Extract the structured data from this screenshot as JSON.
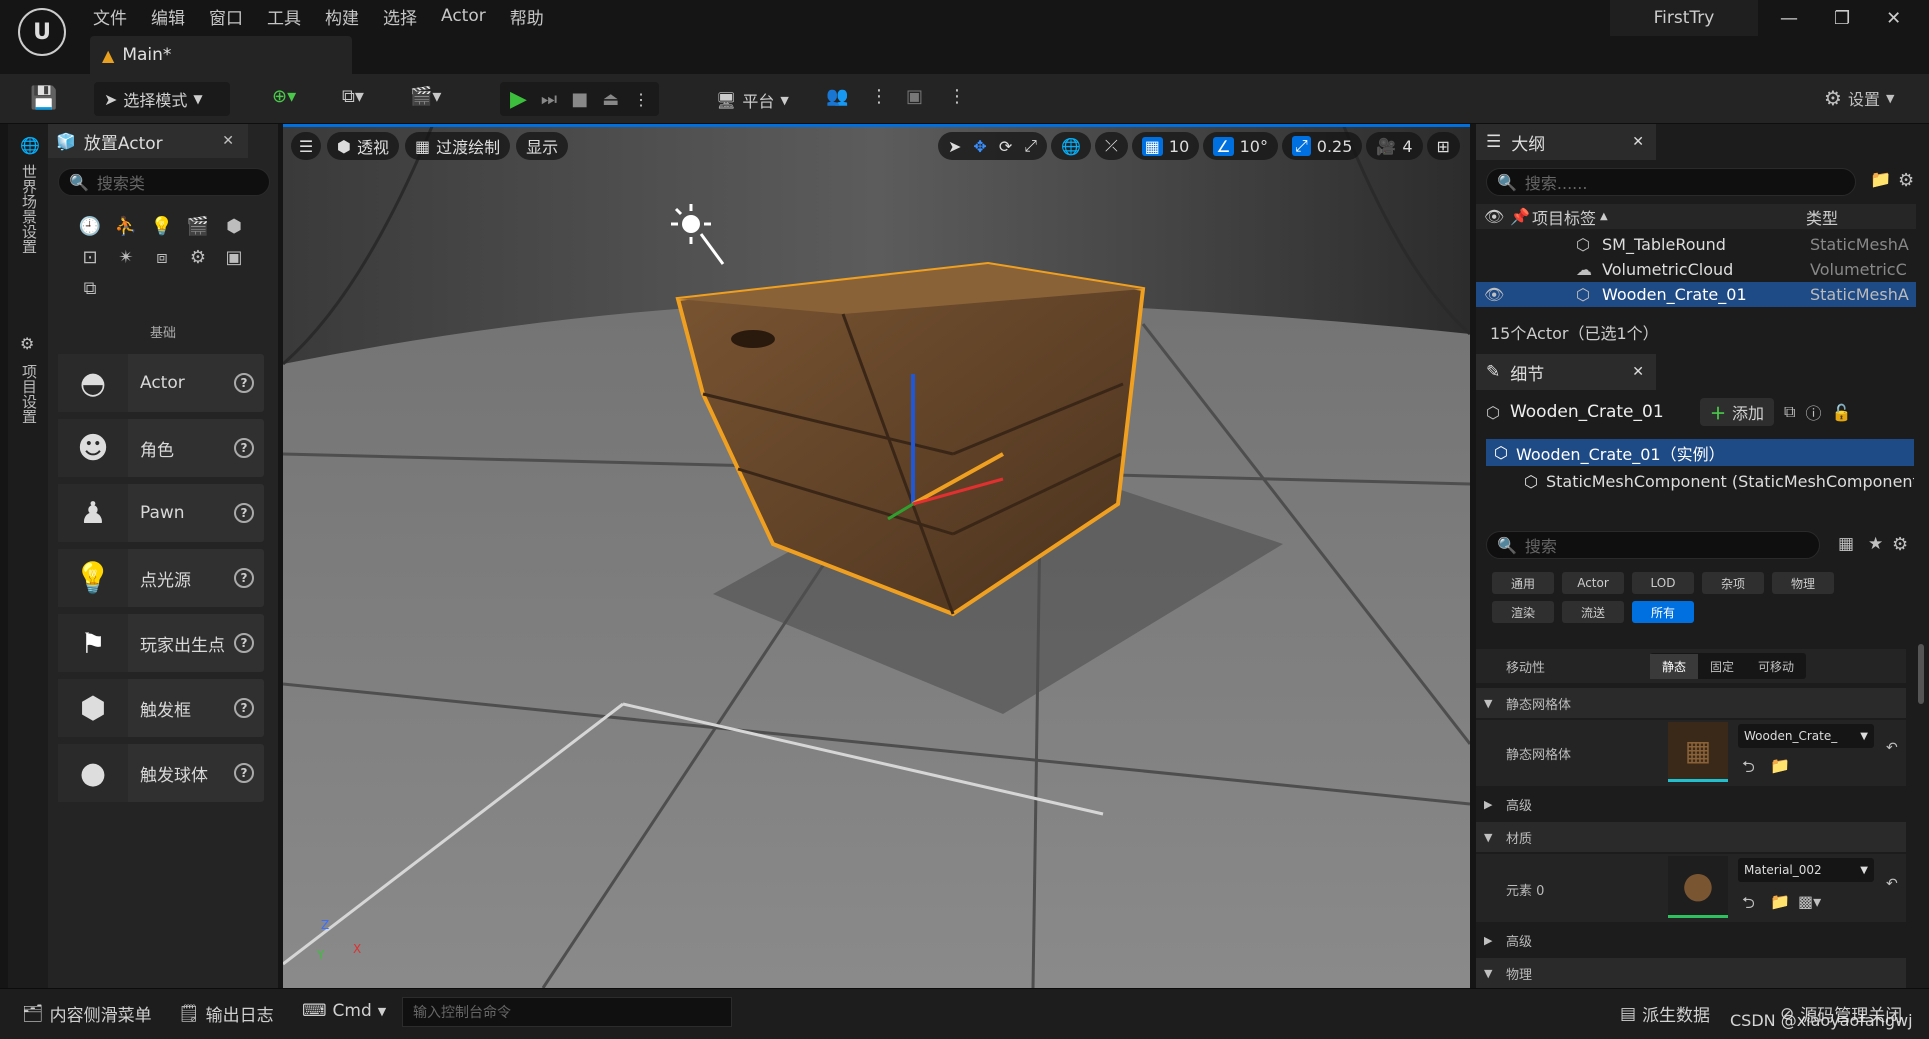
{
  "menu": [
    "文件",
    "编辑",
    "窗口",
    "工具",
    "构建",
    "选择",
    "Actor",
    "帮助"
  ],
  "window": {
    "project": "FirstTry",
    "tab": "Main*"
  },
  "toolbar": {
    "mode": "选择模式",
    "platform": "平台",
    "settings": "设置"
  },
  "left_strip": {
    "world_settings": "世界场景设置",
    "project_settings": "项目设置"
  },
  "place_actor": {
    "title": "放置Actor",
    "search_placeholder": "搜索类",
    "category": "基础",
    "items": [
      "Actor",
      "角色",
      "Pawn",
      "点光源",
      "玩家出生点",
      "触发框",
      "触发球体"
    ]
  },
  "viewport": {
    "perspective": "透视",
    "lit": "过渡绘制",
    "show": "显示",
    "grid_snap": "10",
    "rot_snap": "10°",
    "scale_snap": "0.25",
    "cam_speed": "4",
    "axis": {
      "z": "Z",
      "x": "X",
      "y": "Y"
    }
  },
  "outliner": {
    "title": "大纲",
    "search_placeholder": "搜索......",
    "col_label": "项目标签",
    "col_type": "类型",
    "rows": [
      {
        "name": "SM_TableRound",
        "type": "StaticMeshA"
      },
      {
        "name": "VolumetricCloud",
        "type": "VolumetricC"
      },
      {
        "name": "Wooden_Crate_01",
        "type": "StaticMeshA"
      }
    ],
    "footer": "15个Actor（已选1个）"
  },
  "details": {
    "title": "细节",
    "object_name": "Wooden_Crate_01",
    "add": "添加",
    "instance": "Wooden_Crate_01（实例）",
    "component": "StaticMeshComponent (StaticMeshComponent",
    "search_placeholder": "搜索",
    "filters_row1": [
      "通用",
      "Actor",
      "LOD",
      "杂项",
      "物理"
    ],
    "filters_row2": [
      "渲染",
      "流送",
      "所有"
    ],
    "mobility_label": "移动性",
    "mobility_options": [
      "静态",
      "固定",
      "可移动"
    ],
    "section_static_mesh": "静态网格体",
    "static_mesh_label": "静态网格体",
    "static_mesh_value": "Wooden_Crate_",
    "advanced": "高级",
    "section_material": "材质",
    "element0": "元素 0",
    "material_value": "Material_002",
    "advanced2": "高级",
    "physics": "物理"
  },
  "statusbar": {
    "content_drawer": "内容侧滑菜单",
    "output_log": "输出日志",
    "cmd": "Cmd",
    "console_placeholder": "输入控制台命令",
    "derived_data": "派生数据",
    "source_control": "源码管理关闭",
    "watermark": "CSDN @xiaoyaofangwj"
  },
  "colors": {
    "accent": "#0070e0",
    "selection": "#f0a020",
    "play": "#3cbf3c"
  }
}
